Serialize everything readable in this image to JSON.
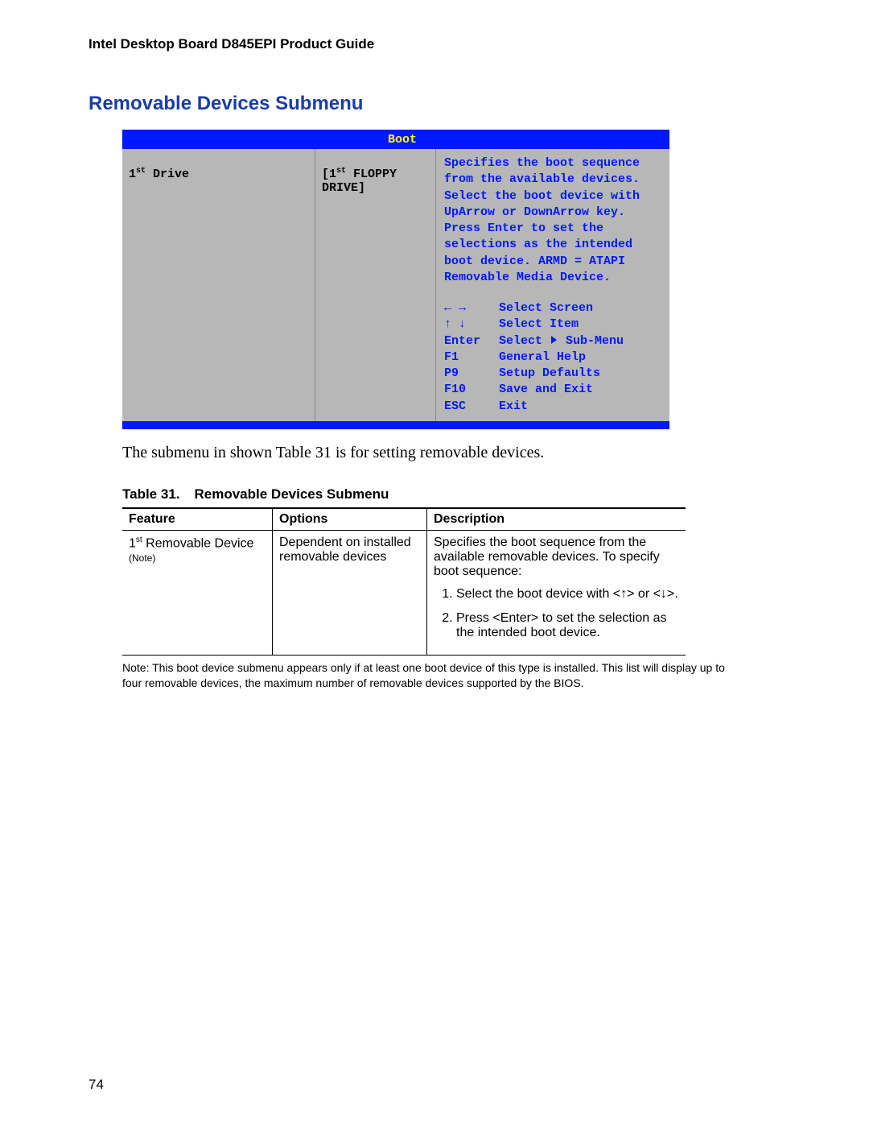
{
  "doc_header": "Intel Desktop Board D845EPI Product Guide",
  "section_heading": "Removable Devices Submenu",
  "bios": {
    "tab": "Boot",
    "left": {
      "drive_ord": "1",
      "drive_sup": "st",
      "drive_label": " Drive",
      "value_pre": "[1",
      "value_sup": "st",
      "value_post": " FLOPPY DRIVE]"
    },
    "right_text": "Specifies the boot sequence from the available devices. Select the boot device with UpArrow or DownArrow key.  Press Enter to set the selections as the intended boot device. ARMD = ATAPI Removable Media Device.",
    "help": [
      {
        "key": "←  →",
        "desc": "Select Screen"
      },
      {
        "key": "↑  ↓",
        "desc": "Select Item"
      },
      {
        "key": "Enter",
        "desc_pre": "Select ",
        "desc_post": " Sub-Menu",
        "tri": true
      },
      {
        "key": "F1",
        "desc": "General Help"
      },
      {
        "key": "P9",
        "desc": "Setup Defaults"
      },
      {
        "key": "F10",
        "desc": "Save and Exit"
      },
      {
        "key": "ESC",
        "desc": "Exit"
      }
    ]
  },
  "intro_line": "The submenu in shown Table 31 is for setting removable devices.",
  "table": {
    "caption_num": "Table 31.",
    "caption_title": "Removable Devices Submenu",
    "headers": {
      "feature": "Feature",
      "options": "Options",
      "description": "Description"
    },
    "row": {
      "feature_ord": "1",
      "feature_sup": "st",
      "feature_rest": " Removable Device",
      "feature_note": "(Note)",
      "options": "Dependent on installed removable devices",
      "desc_intro": "Specifies the boot sequence from the available removable devices.  To specify boot sequence:",
      "steps": [
        "Select the boot device with <↑> or <↓>.",
        "Press <Enter> to set the selection as the intended boot device."
      ]
    }
  },
  "foot_note": "Note: This boot device submenu appears only if at least one boot device of this type is installed.  This list will display up to four removable devices, the maximum number of removable devices supported by the BIOS.",
  "page_number": "74"
}
